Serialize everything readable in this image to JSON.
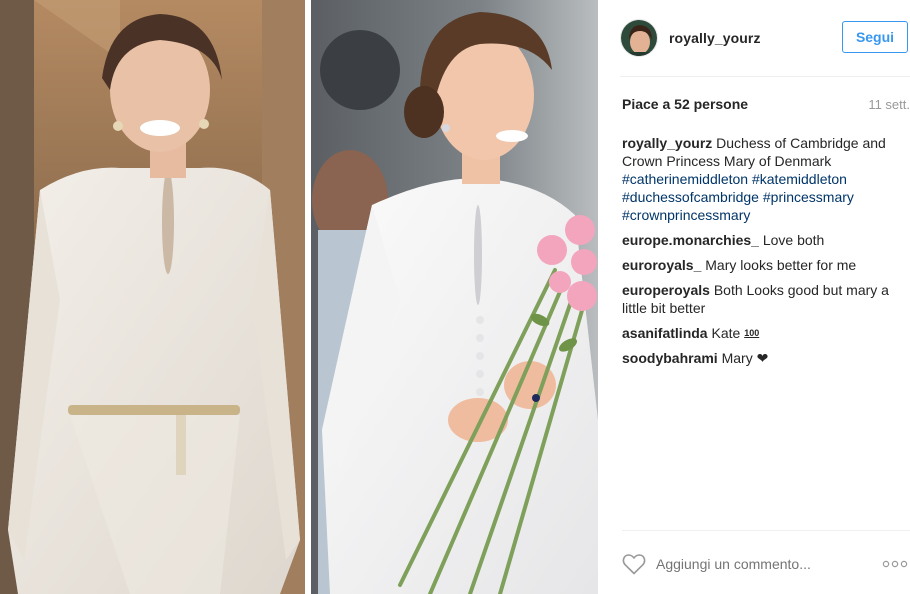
{
  "post": {
    "username": "royally_yourz",
    "follow_label": "Segui",
    "likes": "Piace a 52 persone",
    "age": "11 sett.",
    "caption": {
      "user": "royally_yourz",
      "text": "Duchess of Cambridge and Crown Princess Mary of Denmark",
      "hashtags": [
        "#catherinemiddleton",
        "#katemiddleton",
        "#duchessofcambridge",
        "#princessmary",
        "#crownprincessmary"
      ]
    },
    "comments": [
      {
        "user": "europe.monarchies_",
        "text": "Love both"
      },
      {
        "user": "euroroyals_",
        "text": "Mary looks better for me"
      },
      {
        "user": "europeroyals",
        "text": "Both Looks good but mary a little bit better"
      },
      {
        "user": "asanifatlinda",
        "text": "Kate",
        "emoji": "100"
      },
      {
        "user": "soodybahrami",
        "text": "Mary",
        "emoji": "❤"
      }
    ],
    "add_comment_placeholder": "Aggiungi un commento...",
    "icons": {
      "like": "heart-icon",
      "more": "more-options-icon"
    },
    "colors": {
      "follow": "#3897f0",
      "hashtag": "#003569",
      "muted": "#999999"
    }
  }
}
